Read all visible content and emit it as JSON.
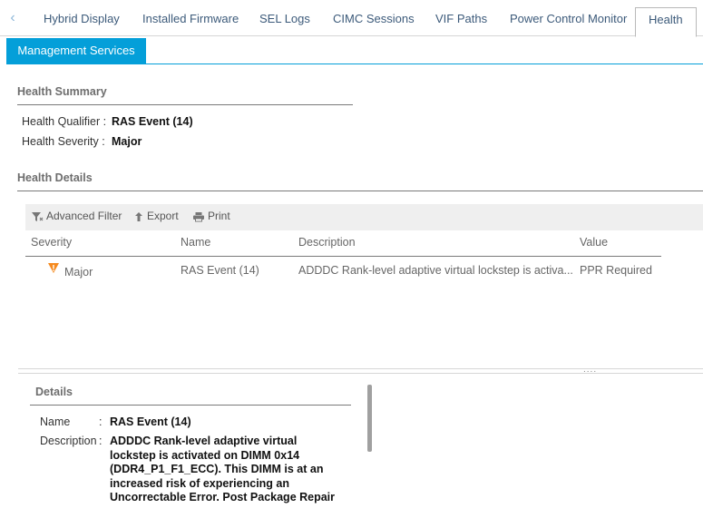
{
  "tabs": [
    {
      "label": "Hybrid Display"
    },
    {
      "label": "Installed Firmware"
    },
    {
      "label": "SEL Logs"
    },
    {
      "label": "CIMC Sessions"
    },
    {
      "label": "VIF Paths"
    },
    {
      "label": "Power Control Monitor"
    },
    {
      "label": "Health"
    }
  ],
  "active_tab": "Health",
  "subtab": {
    "label": "Management Services"
  },
  "health_summary": {
    "title": "Health Summary",
    "qualifier_label": "Health Qualifier",
    "qualifier_value": "RAS Event (14)",
    "severity_label": "Health Severity",
    "severity_value": "Major",
    "separator": ":"
  },
  "health_details": {
    "title": "Health Details",
    "toolbar": {
      "advanced_filter": "Advanced Filter",
      "export": "Export",
      "print": "Print"
    },
    "columns": [
      "Severity",
      "Name",
      "Description",
      "Value"
    ],
    "rows": [
      {
        "severity": "Major",
        "name": "RAS Event (14)",
        "description": "ADDDC Rank-level adaptive virtual lockstep is activa...",
        "value": "PPR Required"
      }
    ]
  },
  "splitter_handle": "....",
  "details": {
    "title": "Details",
    "name_label": "Name",
    "name_value": "RAS Event (14)",
    "description_label": "Description",
    "separator": ":",
    "description_value": "ADDDC Rank-level adaptive virtual lockstep is activated on DIMM 0x14 (DDR4_P1_F1_ECC). This DIMM is at an increased risk of experiencing an Uncorrectable Error. Post Package Repair"
  },
  "colors": {
    "accent": "#049fd9",
    "severity_major": "#f58a1f",
    "tab_text": "#3c5a7a"
  },
  "icons": {
    "back": "chevron-left-icon",
    "filter": "filter-icon",
    "export": "export-arrow-icon",
    "print": "printer-icon",
    "severity": "major-severity-icon"
  }
}
